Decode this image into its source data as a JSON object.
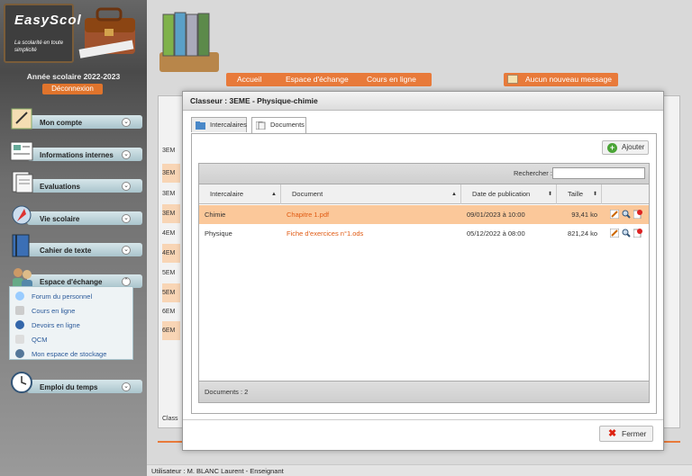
{
  "sidebar": {
    "logo_title": "EasyScol",
    "logo_tagline": "La scolarité en toute simplicité",
    "school_year": "Année scolaire 2022-2023",
    "logout_label": "Déconnexion",
    "menu": [
      {
        "label": "Mon compte"
      },
      {
        "label": "Informations internes"
      },
      {
        "label": "Evaluations"
      },
      {
        "label": "Vie scolaire"
      },
      {
        "label": "Cahier de texte"
      },
      {
        "label": "Espace d'échange"
      },
      {
        "label": "Emploi du temps"
      }
    ],
    "submenu": [
      {
        "label": "Forum du personnel"
      },
      {
        "label": "Cours en ligne"
      },
      {
        "label": "Devoirs en ligne"
      },
      {
        "label": "QCM"
      },
      {
        "label": "Mon espace de stockage"
      }
    ]
  },
  "header": {
    "breadcrumb": [
      "Accueil",
      "Espace d'échange",
      "Cours en ligne"
    ],
    "message": "Aucun nouveau message"
  },
  "background": {
    "row_labels": [
      "3EM",
      "3EM",
      "3EM",
      "3EM",
      "4EM",
      "4EM",
      "5EM",
      "5EM",
      "6EM",
      "6EM"
    ],
    "footer_text": "Class"
  },
  "modal": {
    "title": "Classeur : 3EME - Physique-chimie",
    "tabs": [
      {
        "label": "Intercalaires"
      },
      {
        "label": "Documents"
      }
    ],
    "add_label": "Ajouter",
    "search_label": "Rechercher :",
    "search_value": "",
    "columns": [
      "Intercalaire",
      "Document",
      "Date de publication",
      "Taille"
    ],
    "rows": [
      {
        "intercalaire": "Chimie",
        "document": "Chapitre 1.pdf",
        "date": "09/01/2023 à 10:00",
        "taille": "93,41 ko"
      },
      {
        "intercalaire": "Physique",
        "document": "Fiche d'exercices n°1.ods",
        "date": "05/12/2022 à 08:00",
        "taille": "821,24 ko"
      }
    ],
    "count_label": "Documents : 2",
    "close_label": "Fermer"
  },
  "status_bar": "Utilisateur : M. BLANC Laurent - Enseignant",
  "colors": {
    "accent": "#e87a3a",
    "selected_row": "#fbc89a",
    "link": "#e05a12"
  }
}
